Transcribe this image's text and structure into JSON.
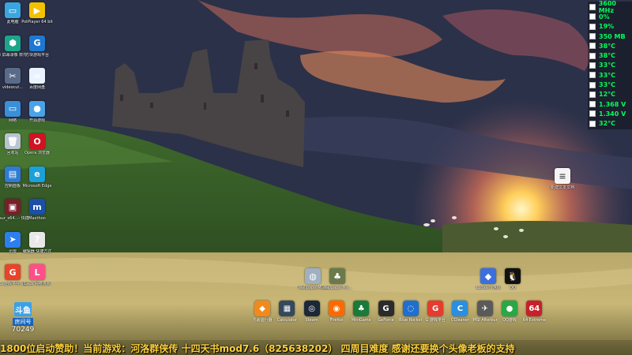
{
  "desktop": {
    "left_icons": [
      {
        "label": "此电脑",
        "icon": "computer-icon",
        "color": "#3aa6e0",
        "glyph": "▭"
      },
      {
        "label": "PotPlayer 64 bit",
        "icon": "potplayer-icon",
        "color": "#f2c200",
        "glyph": "▶"
      },
      {
        "label": "4 屏幕录像 软件",
        "icon": "screen-recorder-icon",
        "color": "#1da58a",
        "glyph": "⬢"
      },
      {
        "label": "方块游戏平台",
        "icon": "game-platform-icon",
        "color": "#1e78d0",
        "glyph": "G"
      },
      {
        "label": "videocut...",
        "icon": "video-cut-icon",
        "color": "#5a6b8a",
        "glyph": "✂"
      },
      {
        "label": "百度网盘",
        "icon": "baidu-netdisk-icon",
        "color": "#e9f2ff",
        "glyph": "∞"
      },
      {
        "label": "网络",
        "icon": "network-icon",
        "color": "#3a8fd8",
        "glyph": "▭"
      },
      {
        "label": "开源游戏",
        "icon": "globe-icon",
        "color": "#4aa3e8",
        "glyph": "●"
      },
      {
        "label": "回收站",
        "icon": "recycle-bin-icon",
        "color": "#b8c4d0",
        "glyph": "🗑"
      },
      {
        "label": "Opera 浏览器",
        "icon": "opera-icon",
        "color": "#d01222",
        "glyph": "O"
      },
      {
        "label": "控制面板",
        "icon": "control-panel-icon",
        "color": "#2e7bd6",
        "glyph": "▤"
      },
      {
        "label": "Microsoft Edge",
        "icon": "edge-icon",
        "color": "#1ca0d8",
        "glyph": "e"
      },
      {
        "label": "cpuz_x64...- 快捷方式",
        "icon": "cpuz-icon",
        "color": "#7a1f2a",
        "glyph": "▣"
      },
      {
        "label": "Maxthon",
        "icon": "maxthon-icon",
        "color": "#1b4fa8",
        "glyph": "m"
      },
      {
        "label": "迅雷",
        "icon": "thunder-icon",
        "color": "#2d7ff0",
        "glyph": "➤"
      },
      {
        "label": "编辑器 快捷方式",
        "icon": "document-question-icon",
        "color": "#e8e8e8",
        "glyph": "?"
      },
      {
        "label": "G 游戏平台 v2",
        "icon": "g-game-icon",
        "color": "#e8432b",
        "glyph": "G"
      },
      {
        "label": "LaLa 网络游戏",
        "icon": "lala-icon",
        "color": "#ff4f8b",
        "glyph": "L"
      }
    ],
    "right_icons": [
      {
        "label": "新建文本文档",
        "icon": "text-file-icon"
      },
      {
        "label": "Ludashi 游戏",
        "icon": "ludashi-icon"
      },
      {
        "label": "QQ",
        "icon": "qq-icon"
      }
    ],
    "mid_icons": [
      {
        "label": "WallpaperMa...",
        "icon": "wallpaper-icon"
      },
      {
        "label": "WallpaperMa...",
        "icon": "wallpaper-tree-icon"
      }
    ],
    "dock": [
      {
        "label": "元素运行器",
        "icon": "runner-icon",
        "color": "#f28a1b",
        "glyph": "◆"
      },
      {
        "label": "Calculator",
        "icon": "calculator-icon",
        "color": "#34495e",
        "glyph": "▦"
      },
      {
        "label": "Steam",
        "icon": "steam-icon",
        "color": "#1b2838",
        "glyph": "◎"
      },
      {
        "label": "Firefox",
        "icon": "firefox-icon",
        "color": "#ff6a00",
        "glyph": "◉"
      },
      {
        "label": "MiniGame",
        "icon": "minigame-icon",
        "color": "#1a7a3a",
        "glyph": "♣"
      },
      {
        "label": "GeForce",
        "icon": "geforce-icon",
        "color": "#2b2b2b",
        "glyph": "G"
      },
      {
        "label": "Blue Rocket",
        "icon": "blue-swirl-icon",
        "color": "#1f6fd0",
        "glyph": "◌"
      },
      {
        "label": "G 游戏平台",
        "icon": "g-platform-icon",
        "color": "#e63b2e",
        "glyph": "G"
      },
      {
        "label": "CCleaner",
        "icon": "ccleaner-icon",
        "color": "#2a8fe0",
        "glyph": "C"
      },
      {
        "label": "MSI Afterburner",
        "icon": "afterburner-icon",
        "color": "#5a5a5a",
        "glyph": "✈"
      },
      {
        "label": "QQ游戏",
        "icon": "qqgame-icon",
        "color": "#2aa845",
        "glyph": "●"
      },
      {
        "label": "64 Extreme",
        "icon": "aida64-icon",
        "color": "#c8202a",
        "glyph": "64"
      }
    ],
    "counter": {
      "app": "斗鱼",
      "tag": "房间号",
      "number": "70249"
    }
  },
  "monitor": [
    {
      "value": "3600 MHz"
    },
    {
      "value": "0%"
    },
    {
      "value": "19%"
    },
    {
      "value": "350 MB"
    },
    {
      "value": "38°C"
    },
    {
      "value": "38°C"
    },
    {
      "value": "33°C"
    },
    {
      "value": "33°C"
    },
    {
      "value": "33°C"
    },
    {
      "value": "12°C"
    },
    {
      "value": "1.368 V"
    },
    {
      "value": "1.340 V"
    },
    {
      "value": "32°C"
    }
  ],
  "marquee": {
    "text": "1800位启动赞助！当前游戏：河洛群侠传 十四天书mod7.6（825638202）  四周目难度  感谢还要换个头像老板的支持"
  }
}
